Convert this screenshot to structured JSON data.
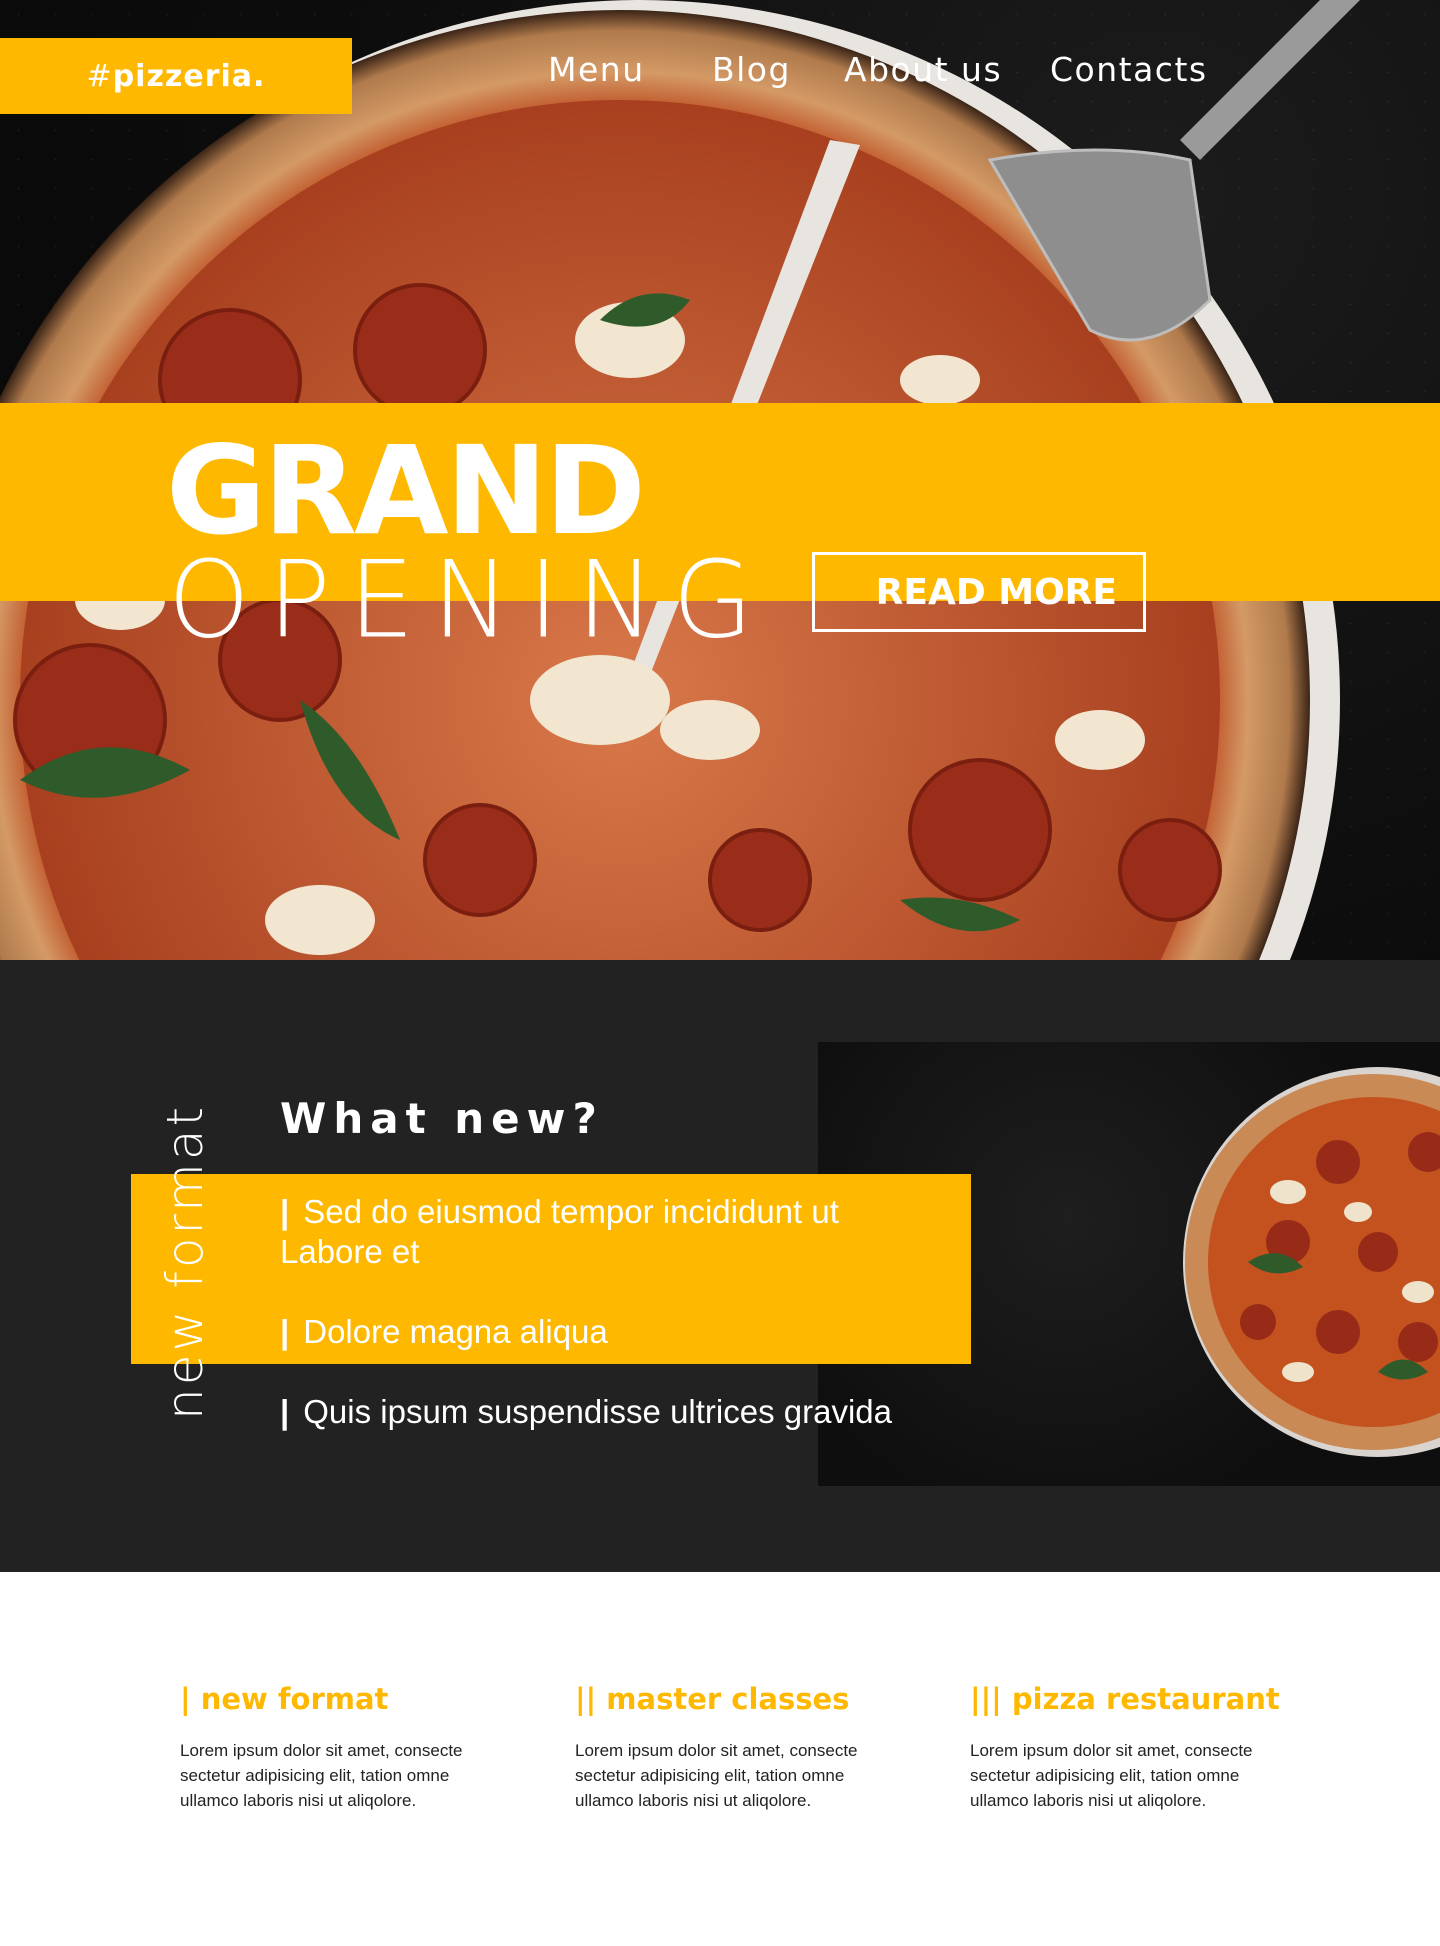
{
  "brand": {
    "hash": "#",
    "name": "pizzeria."
  },
  "nav": [
    "Menu",
    "Blog",
    "About us",
    "Contacts"
  ],
  "hero": {
    "title_bold": "GRAND",
    "title_light": "OPENING",
    "cta": "READ MORE"
  },
  "section": {
    "side_label": "new format",
    "heading": "What new?",
    "items": [
      {
        "bar": "|",
        "line1": "Sed do eiusmod tempor incididunt ut",
        "line2": "Labore et"
      },
      {
        "bar": "|",
        "line1": "Dolore magna aliqua"
      },
      {
        "bar": "|",
        "line1": "Quis ipsum suspendisse ultrices gravida"
      }
    ]
  },
  "features": [
    {
      "mark": "|",
      "title": "new format",
      "lines": [
        "Lorem ipsum dolor sit amet, consecte",
        "sectetur adipisicing elit, tation omne",
        "ullamco laboris nisi ut aliqolore."
      ]
    },
    {
      "mark": "||",
      "title": "master classes",
      "lines": [
        "Lorem ipsum dolor sit amet, consecte",
        "sectetur adipisicing elit, tation omne",
        "ullamco laboris nisi ut aliqolore."
      ]
    },
    {
      "mark": "|||",
      "title": "pizza restaurant",
      "lines": [
        "Lorem ipsum dolor sit amet, consecte",
        "sectetur adipisicing elit, tation omne",
        "ullamco laboris nisi ut aliqolore."
      ]
    }
  ],
  "colors": {
    "accent": "#ffb800",
    "dark": "#222222",
    "text_white": "#ffffff"
  }
}
